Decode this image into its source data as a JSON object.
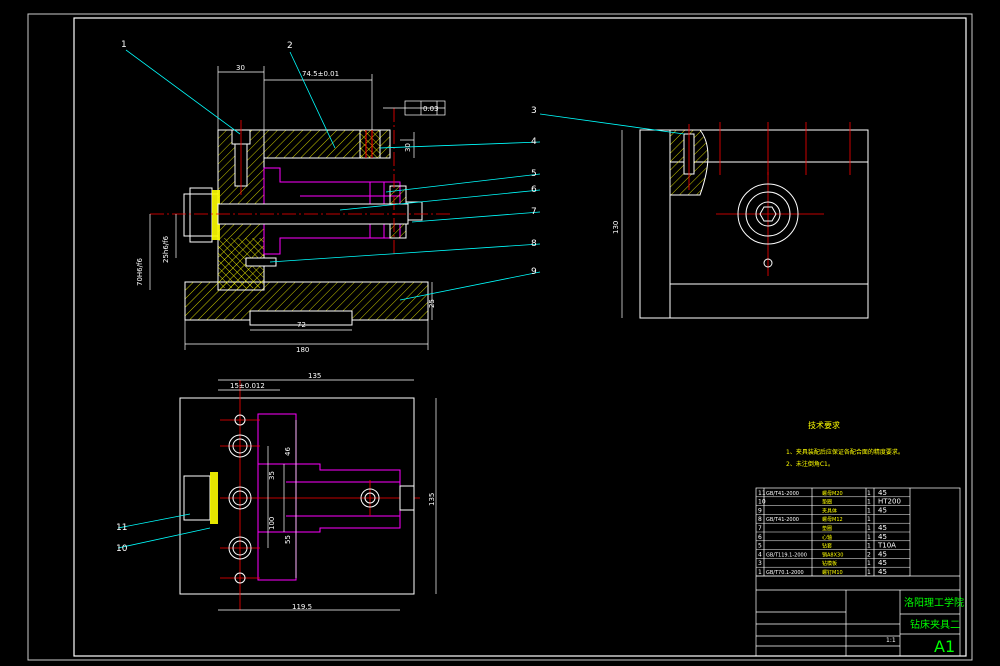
{
  "title_block": {
    "school": "洛阳理工学院",
    "drawing_name": "钻床夹具二",
    "sheet_size": "A1",
    "scale": "1:1"
  },
  "notes": {
    "heading": "技术要求",
    "line1": "1、夹具装配后应保证各配合面的精度要求。",
    "line2": "2、未注倒角C1。"
  },
  "part_callouts": [
    "1",
    "2",
    "3",
    "4",
    "5",
    "6",
    "7",
    "8",
    "9",
    "10",
    "11"
  ],
  "dimensions": {
    "d30": "30",
    "d74": "74.5±0.01",
    "d01": "0.03",
    "d30b": "30",
    "d180": "180",
    "d72": "72",
    "d25": "25",
    "d130": "130",
    "d135": "135",
    "d135v": "135",
    "d15": "15±0.012",
    "d1195": "119.5",
    "d46": "46",
    "d55": "55",
    "d35": "35",
    "d100": "100",
    "dleft1": "25h6/f6",
    "dleft2": "70H6/f6"
  },
  "bom_rows": [
    {
      "no": "11",
      "code": "GB/T41-2000",
      "name": "螺母M20",
      "qty": "1",
      "mat": "45"
    },
    {
      "no": "10",
      "code": "",
      "name": "垫圈",
      "qty": "1",
      "mat": "HT200"
    },
    {
      "no": "9",
      "code": "",
      "name": "夹具体",
      "qty": "1",
      "mat": "45"
    },
    {
      "no": "8",
      "code": "GB/T41-2000",
      "name": "螺母M12",
      "qty": "1",
      "mat": ""
    },
    {
      "no": "7",
      "code": "",
      "name": "垫圈",
      "qty": "1",
      "mat": "45"
    },
    {
      "no": "6",
      "code": "",
      "name": "心轴",
      "qty": "1",
      "mat": "45"
    },
    {
      "no": "5",
      "code": "",
      "name": "钻套",
      "qty": "1",
      "mat": "T10A"
    },
    {
      "no": "4",
      "code": "GB/T119.1-2000",
      "name": "销A8X30",
      "qty": "2",
      "mat": "45"
    },
    {
      "no": "3",
      "code": "",
      "name": "钻模板",
      "qty": "1",
      "mat": "45"
    },
    {
      "no": "1",
      "code": "GB/T70.1-2000",
      "name": "螺钉M10",
      "qty": "1",
      "mat": "45"
    }
  ]
}
